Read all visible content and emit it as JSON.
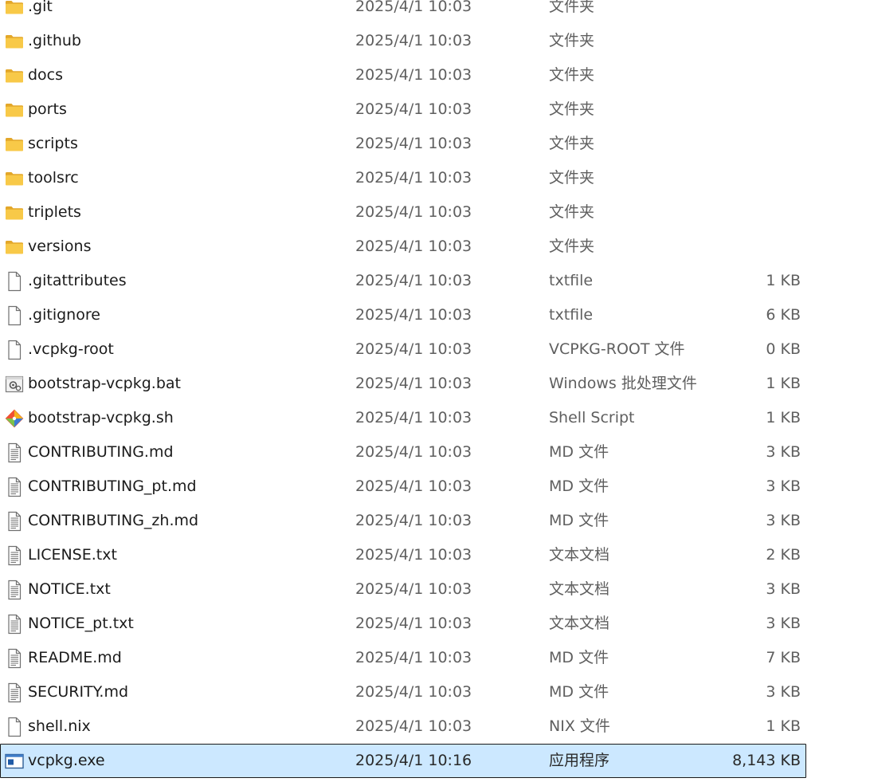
{
  "files": [
    {
      "name": ".git",
      "date": "2025/4/1 10:03",
      "type": "文件夹",
      "size": "",
      "icon": "folder-icon"
    },
    {
      "name": ".github",
      "date": "2025/4/1 10:03",
      "type": "文件夹",
      "size": "",
      "icon": "folder-icon"
    },
    {
      "name": "docs",
      "date": "2025/4/1 10:03",
      "type": "文件夹",
      "size": "",
      "icon": "folder-icon"
    },
    {
      "name": "ports",
      "date": "2025/4/1 10:03",
      "type": "文件夹",
      "size": "",
      "icon": "folder-icon"
    },
    {
      "name": "scripts",
      "date": "2025/4/1 10:03",
      "type": "文件夹",
      "size": "",
      "icon": "folder-icon"
    },
    {
      "name": "toolsrc",
      "date": "2025/4/1 10:03",
      "type": "文件夹",
      "size": "",
      "icon": "folder-icon"
    },
    {
      "name": "triplets",
      "date": "2025/4/1 10:03",
      "type": "文件夹",
      "size": "",
      "icon": "folder-icon"
    },
    {
      "name": "versions",
      "date": "2025/4/1 10:03",
      "type": "文件夹",
      "size": "",
      "icon": "folder-icon"
    },
    {
      "name": ".gitattributes",
      "date": "2025/4/1 10:03",
      "type": "txtfile",
      "size": "1 KB",
      "icon": "blank-file-icon"
    },
    {
      "name": ".gitignore",
      "date": "2025/4/1 10:03",
      "type": "txtfile",
      "size": "6 KB",
      "icon": "blank-file-icon"
    },
    {
      "name": ".vcpkg-root",
      "date": "2025/4/1 10:03",
      "type": "VCPKG-ROOT 文件",
      "size": "0 KB",
      "icon": "blank-file-icon"
    },
    {
      "name": "bootstrap-vcpkg.bat",
      "date": "2025/4/1 10:03",
      "type": "Windows 批处理文件",
      "size": "1 KB",
      "icon": "batch-file-icon"
    },
    {
      "name": "bootstrap-vcpkg.sh",
      "date": "2025/4/1 10:03",
      "type": "Shell Script",
      "size": "1 KB",
      "icon": "git-shell-icon"
    },
    {
      "name": "CONTRIBUTING.md",
      "date": "2025/4/1 10:03",
      "type": "MD 文件",
      "size": "3 KB",
      "icon": "text-file-icon"
    },
    {
      "name": "CONTRIBUTING_pt.md",
      "date": "2025/4/1 10:03",
      "type": "MD 文件",
      "size": "3 KB",
      "icon": "text-file-icon"
    },
    {
      "name": "CONTRIBUTING_zh.md",
      "date": "2025/4/1 10:03",
      "type": "MD 文件",
      "size": "3 KB",
      "icon": "text-file-icon"
    },
    {
      "name": "LICENSE.txt",
      "date": "2025/4/1 10:03",
      "type": "文本文档",
      "size": "2 KB",
      "icon": "text-file-icon"
    },
    {
      "name": "NOTICE.txt",
      "date": "2025/4/1 10:03",
      "type": "文本文档",
      "size": "3 KB",
      "icon": "text-file-icon"
    },
    {
      "name": "NOTICE_pt.txt",
      "date": "2025/4/1 10:03",
      "type": "文本文档",
      "size": "3 KB",
      "icon": "text-file-icon"
    },
    {
      "name": "README.md",
      "date": "2025/4/1 10:03",
      "type": "MD 文件",
      "size": "7 KB",
      "icon": "text-file-icon"
    },
    {
      "name": "SECURITY.md",
      "date": "2025/4/1 10:03",
      "type": "MD 文件",
      "size": "3 KB",
      "icon": "text-file-icon"
    },
    {
      "name": "shell.nix",
      "date": "2025/4/1 10:03",
      "type": "NIX 文件",
      "size": "1 KB",
      "icon": "blank-file-icon"
    },
    {
      "name": "vcpkg.exe",
      "date": "2025/4/1 10:16",
      "type": "应用程序",
      "size": "8,143 KB",
      "icon": "application-icon",
      "selected": true
    }
  ],
  "colors": {
    "selection_bg": "#cce8ff",
    "selection_border": "#1a1a1a",
    "folder": "#f8c948",
    "secondary_text": "#5f5f5f"
  }
}
